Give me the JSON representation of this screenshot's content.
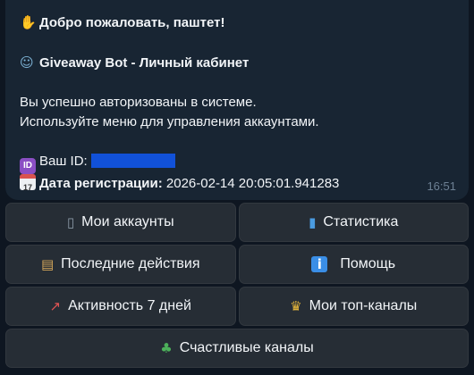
{
  "message": {
    "greeting_emoji": "wave-emoji",
    "greeting": "Добро пожаловать, паштет!",
    "title_emoji": "robot-emoji",
    "title": "Giveaway Bot - Личный кабинет",
    "auth_line1": "Вы успешно авторизованы в системе.",
    "auth_line2": "Используйте меню для управления аккаунтами.",
    "id_badge": "ID",
    "id_label": "Ваш ID:",
    "cal_day": "17",
    "reg_label": "Дата регистрации:",
    "reg_value": "2026-02-14 20:05:01.941283",
    "time": "16:51"
  },
  "keyboard": {
    "my_accounts": "Мои аккаунты",
    "statistics": "Статистика",
    "recent_actions": "Последние действия",
    "help": "Помощь",
    "activity_7d": "Активность 7 дней",
    "top_channels": "Мои топ-каналы",
    "lucky_channels": "Счастливые каналы",
    "help_icon_glyph": "i"
  },
  "colors": {
    "background": "#0e1621",
    "bubble": "#182533",
    "button": "#262d35",
    "redaction": "#1151d8"
  }
}
